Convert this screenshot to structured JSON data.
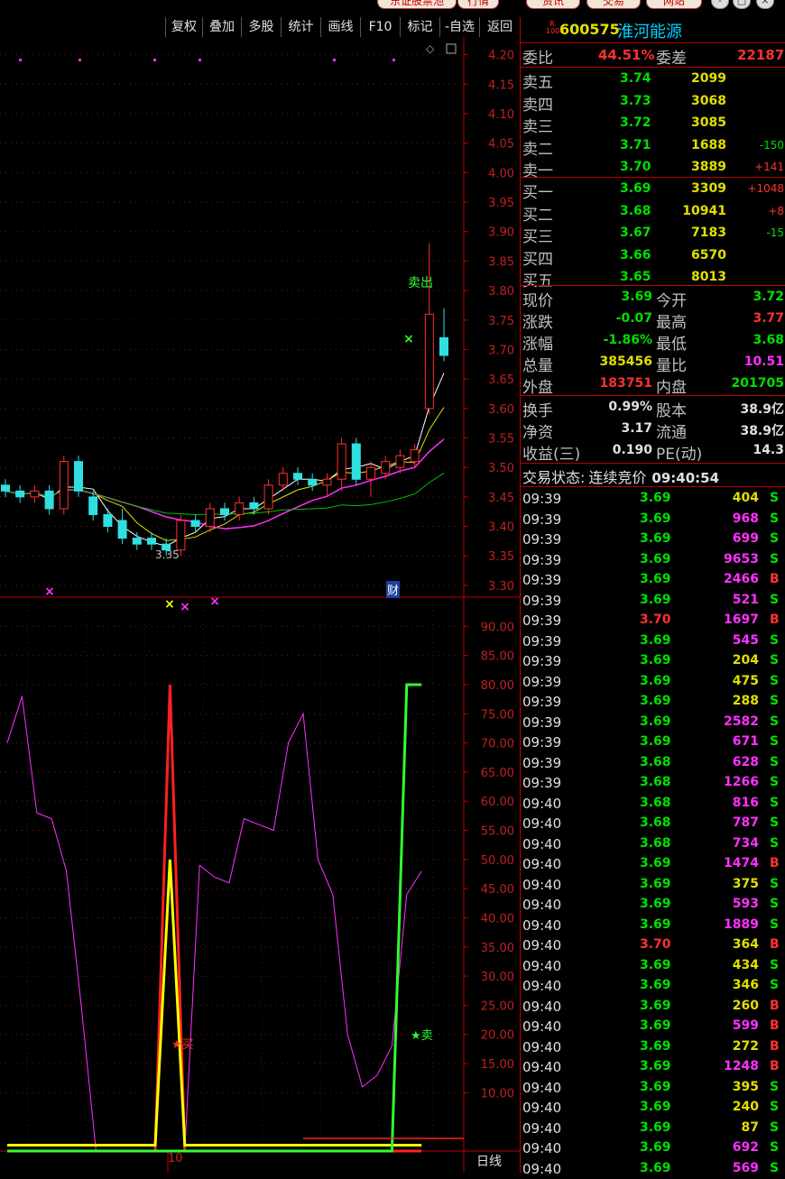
{
  "top_tabs": [
    "东证股票池",
    "行情",
    "资讯",
    "交易",
    "网站"
  ],
  "window_buttons": [
    "-",
    "□",
    "×"
  ],
  "toolbar": [
    "复权",
    "叠加",
    "多股",
    "统计",
    "画线",
    "F10",
    "标记",
    "-自选",
    "返回"
  ],
  "stock": {
    "code": "600575",
    "name": "淮河能源",
    "badge_top": "R",
    "badge_bottom": "1000"
  },
  "order_book": {
    "weibi_label": "委比",
    "weibi": "44.51%",
    "weicha_label": "委差",
    "weicha": "22187",
    "asks": [
      {
        "label": "卖五",
        "price": "3.74",
        "vol": "2099",
        "chg": ""
      },
      {
        "label": "卖四",
        "price": "3.73",
        "vol": "3068",
        "chg": ""
      },
      {
        "label": "卖三",
        "price": "3.72",
        "vol": "3085",
        "chg": ""
      },
      {
        "label": "卖二",
        "price": "3.71",
        "vol": "1688",
        "chg": "-150"
      },
      {
        "label": "卖一",
        "price": "3.70",
        "vol": "3889",
        "chg": "+141"
      }
    ],
    "bids": [
      {
        "label": "买一",
        "price": "3.69",
        "vol": "3309",
        "chg": "+1048"
      },
      {
        "label": "买二",
        "price": "3.68",
        "vol": "10941",
        "chg": "+8"
      },
      {
        "label": "买三",
        "price": "3.67",
        "vol": "7183",
        "chg": "-15"
      },
      {
        "label": "买四",
        "price": "3.66",
        "vol": "6570",
        "chg": ""
      },
      {
        "label": "买五",
        "price": "3.65",
        "vol": "8013",
        "chg": ""
      }
    ]
  },
  "quote": [
    {
      "l1": "现价",
      "v1": "3.69",
      "c1": "#00e000",
      "l2": "今开",
      "v2": "3.72",
      "c2": "#00e000"
    },
    {
      "l1": "涨跌",
      "v1": "-0.07",
      "c1": "#00e000",
      "l2": "最高",
      "v2": "3.77",
      "c2": "#ff3030"
    },
    {
      "l1": "涨幅",
      "v1": "-1.86%",
      "c1": "#00e000",
      "l2": "最低",
      "v2": "3.68",
      "c2": "#00e000"
    },
    {
      "l1": "总量",
      "v1": "385456",
      "c1": "#e0e000",
      "l2": "量比",
      "v2": "10.51",
      "c2": "#ff30ff"
    },
    {
      "l1": "外盘",
      "v1": "183751",
      "c1": "#ff3030",
      "l2": "内盘",
      "v2": "201705",
      "c2": "#00e000"
    }
  ],
  "fund": [
    {
      "l1": "换手",
      "v1": "0.99%",
      "l2": "股本",
      "v2": "38.9亿"
    },
    {
      "l1": "净资",
      "v1": "3.17",
      "l2": "流通",
      "v2": "38.9亿"
    },
    {
      "l1": "收益(三)",
      "v1": "0.190",
      "l2": "PE(动)",
      "v2": "14.3"
    }
  ],
  "status": {
    "label": "交易状态:",
    "value": "连续竞价",
    "time": "09:40:54"
  },
  "ticks": [
    [
      "09:39",
      "3.69",
      "404",
      "S"
    ],
    [
      "09:39",
      "3.69",
      "968",
      "S"
    ],
    [
      "09:39",
      "3.69",
      "699",
      "S"
    ],
    [
      "09:39",
      "3.69",
      "9653",
      "S"
    ],
    [
      "09:39",
      "3.69",
      "2466",
      "B"
    ],
    [
      "09:39",
      "3.69",
      "521",
      "S"
    ],
    [
      "09:39",
      "3.70",
      "1697",
      "B"
    ],
    [
      "09:39",
      "3.69",
      "545",
      "S"
    ],
    [
      "09:39",
      "3.69",
      "204",
      "S"
    ],
    [
      "09:39",
      "3.69",
      "475",
      "S"
    ],
    [
      "09:39",
      "3.69",
      "288",
      "S"
    ],
    [
      "09:39",
      "3.69",
      "2582",
      "S"
    ],
    [
      "09:39",
      "3.69",
      "671",
      "S"
    ],
    [
      "09:39",
      "3.68",
      "628",
      "S"
    ],
    [
      "09:39",
      "3.68",
      "1266",
      "S"
    ],
    [
      "09:40",
      "3.68",
      "816",
      "S"
    ],
    [
      "09:40",
      "3.68",
      "787",
      "S"
    ],
    [
      "09:40",
      "3.68",
      "734",
      "S"
    ],
    [
      "09:40",
      "3.69",
      "1474",
      "B"
    ],
    [
      "09:40",
      "3.69",
      "375",
      "S"
    ],
    [
      "09:40",
      "3.69",
      "593",
      "S"
    ],
    [
      "09:40",
      "3.69",
      "1889",
      "S"
    ],
    [
      "09:40",
      "3.70",
      "364",
      "B"
    ],
    [
      "09:40",
      "3.69",
      "434",
      "S"
    ],
    [
      "09:40",
      "3.69",
      "346",
      "S"
    ],
    [
      "09:40",
      "3.69",
      "260",
      "B"
    ],
    [
      "09:40",
      "3.69",
      "599",
      "B"
    ],
    [
      "09:40",
      "3.69",
      "272",
      "B"
    ],
    [
      "09:40",
      "3.69",
      "1248",
      "B"
    ],
    [
      "09:40",
      "3.69",
      "395",
      "S"
    ],
    [
      "09:40",
      "3.69",
      "240",
      "S"
    ],
    [
      "09:40",
      "3.69",
      "87",
      "S"
    ],
    [
      "09:40",
      "3.69",
      "692",
      "S"
    ],
    [
      "09:40",
      "3.69",
      "569",
      "S"
    ]
  ],
  "tick_colors": {
    "price_green": "#00e000",
    "price_red": "#ff3030",
    "vol_yellow": "#e0e000",
    "vol_magenta": "#ff30ff",
    "S": "#00e000",
    "B": "#ff3030"
  },
  "chart_data": [
    {
      "type": "candlestick",
      "yticks": [
        "4.20",
        "4.15",
        "4.10",
        "4.05",
        "4.00",
        "3.95",
        "3.90",
        "3.85",
        "3.80",
        "3.75",
        "3.70",
        "3.65",
        "3.60",
        "3.55",
        "3.50",
        "3.45",
        "3.40",
        "3.35",
        "3.30"
      ],
      "ylim": [
        3.28,
        4.23
      ],
      "annotations": {
        "sell": "卖出",
        "low": "3.35",
        "cai": "财"
      },
      "candles": [
        {
          "o": 3.47,
          "c": 3.46,
          "h": 3.48,
          "l": 3.45
        },
        {
          "o": 3.46,
          "c": 3.45,
          "h": 3.47,
          "l": 3.44
        },
        {
          "o": 3.45,
          "c": 3.46,
          "h": 3.47,
          "l": 3.44
        },
        {
          "o": 3.46,
          "c": 3.43,
          "h": 3.47,
          "l": 3.42
        },
        {
          "o": 3.43,
          "c": 3.51,
          "h": 3.52,
          "l": 3.42
        },
        {
          "o": 3.51,
          "c": 3.46,
          "h": 3.52,
          "l": 3.45
        },
        {
          "o": 3.45,
          "c": 3.42,
          "h": 3.46,
          "l": 3.41
        },
        {
          "o": 3.42,
          "c": 3.4,
          "h": 3.43,
          "l": 3.39
        },
        {
          "o": 3.41,
          "c": 3.38,
          "h": 3.43,
          "l": 3.37
        },
        {
          "o": 3.38,
          "c": 3.37,
          "h": 3.39,
          "l": 3.36
        },
        {
          "o": 3.38,
          "c": 3.37,
          "h": 3.39,
          "l": 3.36
        },
        {
          "o": 3.37,
          "c": 3.36,
          "h": 3.38,
          "l": 3.35
        },
        {
          "o": 3.36,
          "c": 3.41,
          "h": 3.42,
          "l": 3.35
        },
        {
          "o": 3.41,
          "c": 3.4,
          "h": 3.42,
          "l": 3.39
        },
        {
          "o": 3.4,
          "c": 3.43,
          "h": 3.44,
          "l": 3.39
        },
        {
          "o": 3.43,
          "c": 3.42,
          "h": 3.44,
          "l": 3.41
        },
        {
          "o": 3.42,
          "c": 3.44,
          "h": 3.45,
          "l": 3.41
        },
        {
          "o": 3.44,
          "c": 3.43,
          "h": 3.45,
          "l": 3.42
        },
        {
          "o": 3.43,
          "c": 3.47,
          "h": 3.48,
          "l": 3.42
        },
        {
          "o": 3.47,
          "c": 3.49,
          "h": 3.5,
          "l": 3.46
        },
        {
          "o": 3.49,
          "c": 3.48,
          "h": 3.5,
          "l": 3.47
        },
        {
          "o": 3.48,
          "c": 3.47,
          "h": 3.49,
          "l": 3.46
        },
        {
          "o": 3.47,
          "c": 3.48,
          "h": 3.49,
          "l": 3.45
        },
        {
          "o": 3.48,
          "c": 3.54,
          "h": 3.55,
          "l": 3.46
        },
        {
          "o": 3.54,
          "c": 3.48,
          "h": 3.55,
          "l": 3.47
        },
        {
          "o": 3.48,
          "c": 3.5,
          "h": 3.51,
          "l": 3.45
        },
        {
          "o": 3.49,
          "c": 3.51,
          "h": 3.52,
          "l": 3.48
        },
        {
          "o": 3.5,
          "c": 3.52,
          "h": 3.53,
          "l": 3.49
        },
        {
          "o": 3.51,
          "c": 3.53,
          "h": 3.54,
          "l": 3.5
        },
        {
          "o": 3.6,
          "c": 3.76,
          "h": 3.88,
          "l": 3.59
        },
        {
          "o": 3.72,
          "c": 3.69,
          "h": 3.77,
          "l": 3.68
        }
      ]
    },
    {
      "type": "line",
      "yticks": [
        "90.00",
        "85.00",
        "80.00",
        "75.00",
        "70.00",
        "65.00",
        "60.00",
        "55.00",
        "50.00",
        "45.00",
        "40.00",
        "35.00",
        "30.00",
        "25.00",
        "20.00",
        "15.00",
        "10.00"
      ],
      "ylim": [
        0,
        95
      ],
      "xtick": "10",
      "period": "日线",
      "annotations": {
        "buy": "★买",
        "sell": "★卖"
      },
      "series": [
        {
          "color": "#ff30ff",
          "values": [
            70,
            78,
            58,
            57,
            48,
            25,
            0,
            0,
            0,
            0,
            0,
            0,
            0,
            49,
            47,
            46,
            57,
            56,
            55,
            70,
            75,
            50,
            44,
            20,
            11,
            13,
            18,
            44,
            48
          ]
        },
        {
          "color": "#ff2020",
          "values": [
            0,
            0,
            0,
            0,
            0,
            0,
            0,
            0,
            0,
            0,
            0,
            80,
            0,
            0,
            0,
            0,
            0,
            0,
            0,
            0,
            0,
            0,
            0,
            0,
            0,
            0,
            0,
            0,
            0
          ]
        },
        {
          "color": "#ffff00",
          "values": [
            1,
            1,
            1,
            1,
            1,
            1,
            1,
            1,
            1,
            1,
            1,
            50,
            1,
            1,
            1,
            1,
            1,
            1,
            1,
            1,
            1,
            1,
            1,
            1,
            1,
            1,
            1,
            1,
            1
          ]
        },
        {
          "color": "#30ff30",
          "values": [
            0,
            0,
            0,
            0,
            0,
            0,
            0,
            0,
            0,
            0,
            0,
            0,
            0,
            0,
            0,
            0,
            0,
            0,
            0,
            0,
            0,
            0,
            0,
            0,
            0,
            0,
            0,
            80,
            80
          ]
        }
      ]
    }
  ]
}
